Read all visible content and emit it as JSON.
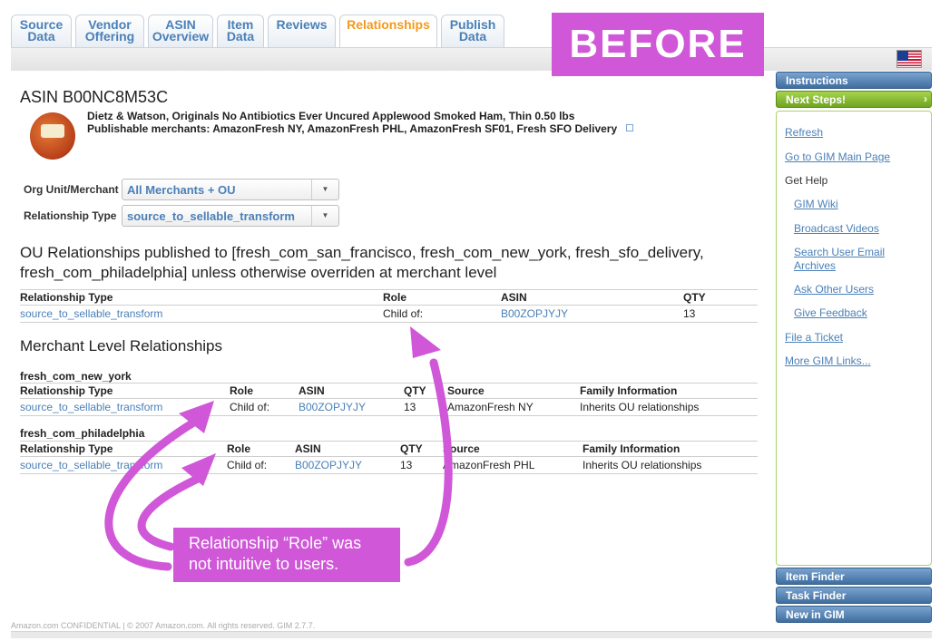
{
  "tabs": [
    {
      "line1": "Source",
      "line2": "Data",
      "active": false
    },
    {
      "line1": "Vendor",
      "line2": "Offering",
      "active": false
    },
    {
      "line1": "ASIN",
      "line2": "Overview",
      "active": false
    },
    {
      "line1": "Item",
      "line2": "Data",
      "active": false
    },
    {
      "line1": "Reviews",
      "line2": "",
      "active": false
    },
    {
      "line1": "Relationships",
      "line2": "",
      "active": true
    },
    {
      "line1": "Publish",
      "line2": "Data",
      "active": false
    }
  ],
  "banner": {
    "label": "BEFORE",
    "color": "#cf57d8"
  },
  "flag_icon": "us-flag-icon",
  "asin": {
    "title": "ASIN B00NC8M53C",
    "product_name": "Dietz & Watson, Originals No Antibiotics Ever Uncured Applewood Smoked Ham, Thin 0.50 lbs",
    "publishable": "Publishable merchants: AmazonFresh NY, AmazonFresh PHL, AmazonFresh SF01, Fresh SFO Delivery"
  },
  "filters": {
    "org_unit_label": "Org Unit/Merchant",
    "org_unit_value": "All Merchants + OU",
    "relationship_type_label": "Relationship Type",
    "relationship_type_value": "source_to_sellable_transform"
  },
  "ou_section": {
    "heading_line1": "OU Relationships  published to [fresh_com_san_francisco, fresh_com_new_york, fresh_sfo_delivery,",
    "heading_line2": "fresh_com_philadelphia] unless otherwise overriden at merchant level",
    "columns": [
      "Relationship Type",
      "Role",
      "ASIN",
      "QTY"
    ],
    "rows": [
      {
        "relationship_type": "source_to_sellable_transform",
        "role": "Child of:",
        "asin": "B00ZOPJYJY",
        "qty": "13"
      }
    ]
  },
  "merchant_section": {
    "heading": "Merchant Level Relationships",
    "merchants": [
      {
        "name": "fresh_com_new_york",
        "columns": [
          "Relationship Type",
          "Role",
          "ASIN",
          "QTY",
          "Source",
          "Family Information"
        ],
        "rows": [
          {
            "relationship_type": "source_to_sellable_transform",
            "role": "Child of:",
            "asin": "B00ZOPJYJY",
            "qty": "13",
            "source": "AmazonFresh NY",
            "family": "Inherits OU relationships"
          }
        ]
      },
      {
        "name": "fresh_com_philadelphia",
        "columns": [
          "Relationship Type",
          "Role",
          "ASIN",
          "QTY",
          "Source",
          "Family Information"
        ],
        "rows": [
          {
            "relationship_type": "source_to_sellable_transform",
            "role": "Child of:",
            "asin": "B00ZOPJYJY",
            "qty": "13",
            "source": "AmazonFresh PHL",
            "family": "Inherits OU relationships"
          }
        ]
      }
    ]
  },
  "sidebar": {
    "instructions": "Instructions",
    "next_steps": "Next Steps!",
    "links": {
      "refresh": "Refresh",
      "gim_main": "Go to GIM Main Page",
      "get_help": "Get Help",
      "gim_wiki": "GIM Wiki",
      "broadcast_videos": "Broadcast Videos",
      "search_archives_1": "Search User Email",
      "search_archives_2": "Archives",
      "ask_users": "Ask Other Users",
      "give_feedback": "Give Feedback",
      "file_ticket": "File a Ticket",
      "more_links": "More GIM Links..."
    },
    "item_finder": "Item Finder",
    "task_finder": "Task Finder",
    "new_in_gim": "New in GIM"
  },
  "callout": {
    "line1": "Relationship “Role” was",
    "line2": "not intuitive to users."
  },
  "footer": "Amazon.com CONFIDENTIAL | © 2007 Amazon.com. All rights reserved. GIM 2.7.7.",
  "colors": {
    "link": "#4a80b8",
    "active_tab": "#f39a1e",
    "annotation": "#cf57d8"
  }
}
